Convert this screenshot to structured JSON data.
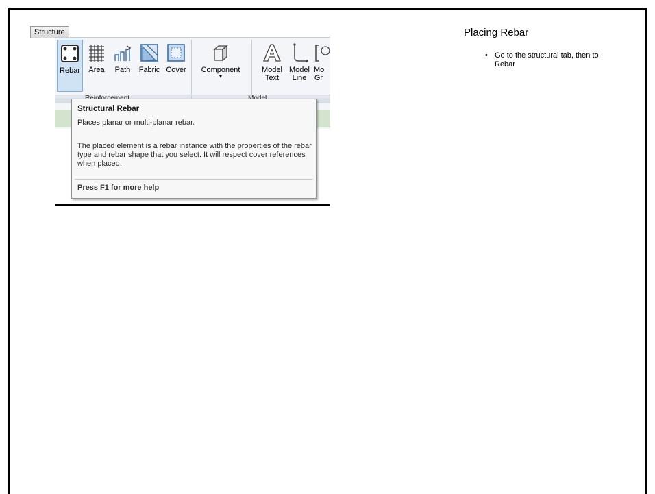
{
  "ribbon": {
    "tab_label": "Structure",
    "tools": {
      "rebar": "Rebar",
      "area": "Area",
      "path": "Path",
      "fabric": "Fabric",
      "cover": "Cover",
      "component": "Component",
      "model_text": "Model Text",
      "model_line": "Model Line",
      "model_group_partial": "Mo Gr"
    },
    "panels": {
      "reinforcement": "Reinforcement",
      "model": "Model"
    }
  },
  "tooltip": {
    "title": "Structural Rebar",
    "summary": "Places planar or multi-planar rebar.",
    "description": "The placed element is a rebar instance with the properties of the rebar type and rebar shape that you select. It will respect cover references when placed.",
    "help": "Press F1 for more help"
  },
  "slide": {
    "title": "Placing Rebar",
    "bullets": [
      "Go to the structural tab, then to Rebar"
    ]
  },
  "colors": {
    "ribbon_bg": "#f3f5f8",
    "selected_tool": "#cfe3f4",
    "icon_blue": "#3c6fa8",
    "tooltip_bg": "#f7f7f7"
  }
}
